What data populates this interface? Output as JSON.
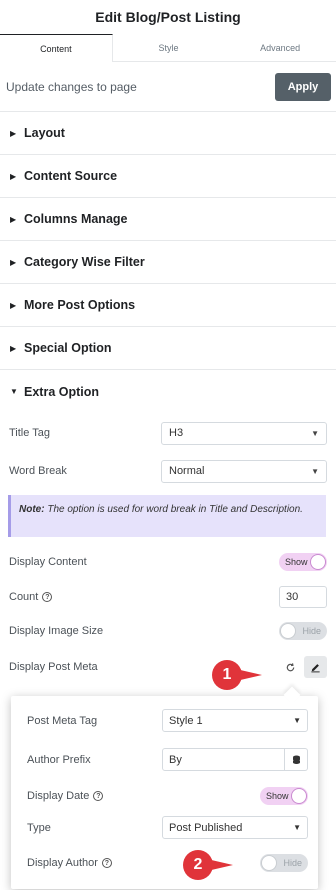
{
  "header": {
    "title": "Edit Blog/Post Listing"
  },
  "tabs": [
    {
      "label": "Content",
      "active": true
    },
    {
      "label": "Style",
      "active": false
    },
    {
      "label": "Advanced",
      "active": false
    }
  ],
  "update": {
    "text": "Update changes to page",
    "apply_label": "Apply"
  },
  "sections": [
    {
      "title": "Layout"
    },
    {
      "title": "Content Source"
    },
    {
      "title": "Columns Manage"
    },
    {
      "title": "Category Wise Filter"
    },
    {
      "title": "More Post Options"
    },
    {
      "title": "Special Option"
    },
    {
      "title": "Extra Option"
    }
  ],
  "extra": {
    "title_tag": {
      "label": "Title Tag",
      "value": "H3"
    },
    "word_break": {
      "label": "Word Break",
      "value": "Normal"
    },
    "note": {
      "bold": "Note:",
      "text": " The option is used for word break in Title and Description."
    },
    "display_content": {
      "label": "Display Content",
      "state": "Show"
    },
    "count": {
      "label": "Count",
      "value": "30"
    },
    "display_image_size": {
      "label": "Display Image Size",
      "state": "Hide"
    },
    "display_post_meta": {
      "label": "Display Post Meta"
    }
  },
  "popover": {
    "post_meta_tag": {
      "label": "Post Meta Tag",
      "value": "Style 1"
    },
    "author_prefix": {
      "label": "Author Prefix",
      "value": "By"
    },
    "display_date": {
      "label": "Display Date",
      "state": "Show"
    },
    "type": {
      "label": "Type",
      "value": "Post Published"
    },
    "display_author": {
      "label": "Display Author",
      "state": "Hide"
    }
  },
  "markers": {
    "one": "1",
    "two": "2"
  },
  "colors": {
    "apply_bg": "#556068",
    "toggle_on": "#f1d1f3",
    "note_bg": "#e6e2fb",
    "marker": "#e0343a"
  }
}
